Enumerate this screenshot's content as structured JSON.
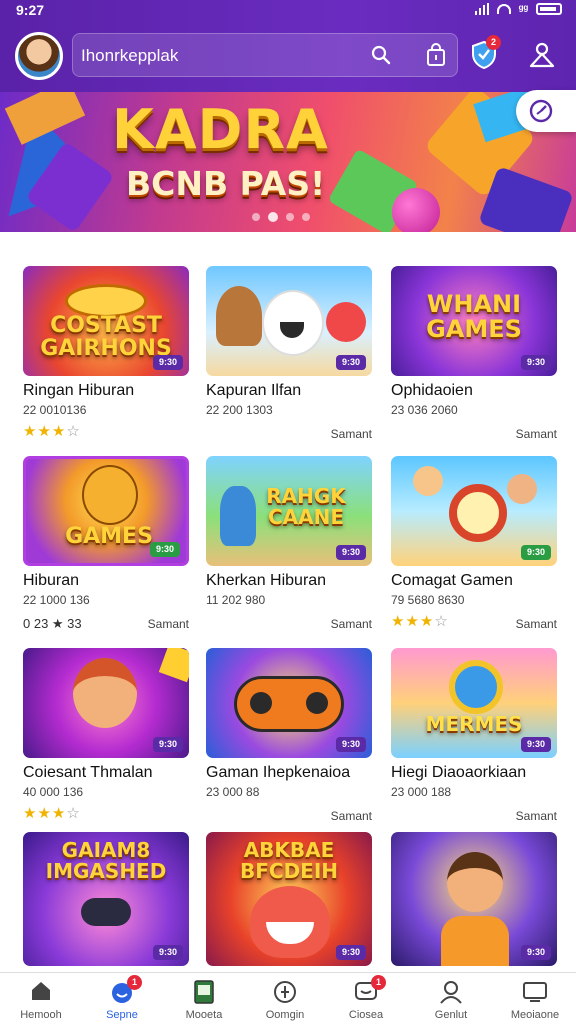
{
  "status_bar": {
    "time": "9:27"
  },
  "header": {
    "search_text": "Ihonrkepplak",
    "notification_count": "2",
    "icons": [
      "avatar",
      "search-icon",
      "shopping-bag-icon",
      "shield-icon",
      "people-icon"
    ]
  },
  "banner": {
    "title": "KADRA",
    "subtitle": "BCNB PAS!",
    "slide_count": 4,
    "active_slide": 2
  },
  "games": [
    {
      "thumb_text": "COSTAST\nGAIRHONS",
      "badge": "9:30",
      "title": "Ringan Hiburan",
      "meta": "22 0010136",
      "rating": 3,
      "right": "Samant",
      "theme": "orange"
    },
    {
      "thumb_text": "",
      "badge": "9:30",
      "title": "Kapuran Ilfan",
      "meta": "22 200 1303",
      "rating": null,
      "right": "Samant",
      "theme": "blue"
    },
    {
      "thumb_text": "WHANI\nGAMES",
      "badge": "9:30",
      "title": "Ophidaoien",
      "meta": "23 036 2060",
      "rating": null,
      "right": "Samant",
      "theme": "purple"
    },
    {
      "thumb_text": "GAMES",
      "badge": "9:30",
      "title": "Hiburan",
      "meta": "22 1000 136",
      "rating_text": "0 23 ★ 33",
      "right": "Samant",
      "theme": "violet"
    },
    {
      "thumb_text": "RAHGK\nCAANE",
      "badge": "9:30",
      "title": "Kherkan Hiburan",
      "meta": "11 202 980",
      "rating": null,
      "right": "Samant",
      "theme": "jungle"
    },
    {
      "thumb_text": "",
      "badge": "9:30",
      "title": "Comagat Gamen",
      "meta": "79 5680 8630",
      "rating": 3,
      "right": "Samant",
      "theme": "sky"
    },
    {
      "thumb_text": "",
      "badge": "9:30",
      "title": "Coiesant Thmalan",
      "meta": "40 000 136",
      "rating": 3,
      "right": "",
      "theme": "magenta"
    },
    {
      "thumb_text": "",
      "badge": "9:30",
      "title": "Gaman Ihepkenaioa",
      "meta": "23 000 88",
      "rating": null,
      "right": "Samant",
      "theme": "controller"
    },
    {
      "thumb_text": "MERMES",
      "badge": "9:30",
      "title": "Hiegi Diaoaorkiaan",
      "meta": "23 000 188",
      "rating": null,
      "right": "Samant",
      "theme": "beach"
    },
    {
      "thumb_text": "GAIAM8\nIMGASHED",
      "badge": "9:30",
      "title": "",
      "meta": "",
      "rating": null,
      "right": "",
      "theme": "party"
    },
    {
      "thumb_text": "ABKBAE\nBFCDEIH",
      "badge": "9:30",
      "title": "",
      "meta": "",
      "rating": null,
      "right": "",
      "theme": "monster"
    },
    {
      "thumb_text": "",
      "badge": "9:30",
      "title": "",
      "meta": "",
      "rating": null,
      "right": "",
      "theme": "hero"
    }
  ],
  "bottom_nav": [
    {
      "label": "Hemooh",
      "icon": "home-icon"
    },
    {
      "label": "Sepne",
      "icon": "chat-icon",
      "badge": "1",
      "active": true
    },
    {
      "label": "Mooeta",
      "icon": "book-icon"
    },
    {
      "label": "Oomgin",
      "icon": "compass-icon"
    },
    {
      "label": "Ciosea",
      "icon": "message-icon",
      "badge": "1"
    },
    {
      "label": "Genlut",
      "icon": "profile-icon"
    },
    {
      "label": "Meoiaone",
      "icon": "tv-icon"
    }
  ],
  "colors": {
    "header": "#6a2cc0",
    "accent": "#2a62e0",
    "star": "#f0b400",
    "badge": "#5b2aa6"
  }
}
